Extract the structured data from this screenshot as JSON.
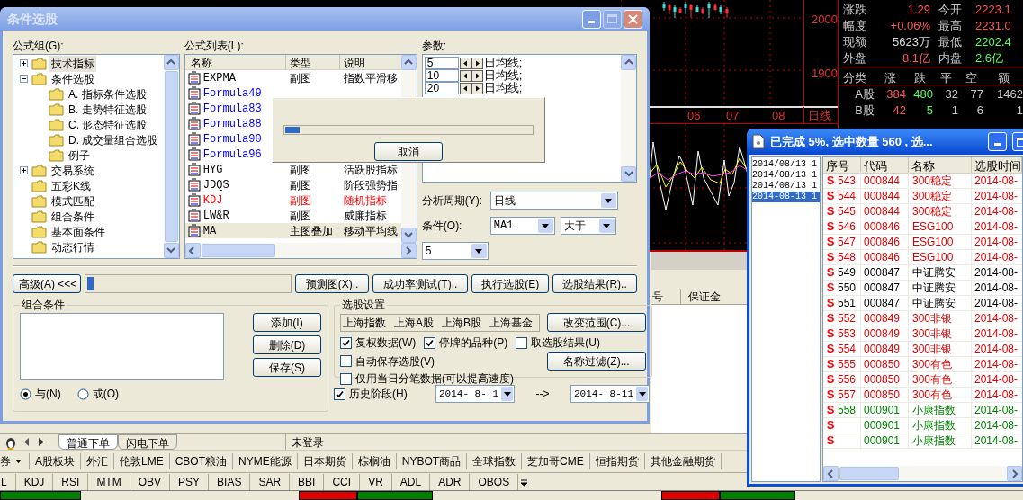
{
  "background": {
    "price_chart": {
      "y_labels": [
        "2000",
        "1900"
      ],
      "x_labels": [
        "06",
        "07",
        "08"
      ],
      "period": "日线"
    },
    "quote": {
      "stats": [
        {
          "label": "涨跌",
          "value": "1.29",
          "color": "#ff5555"
        },
        {
          "label": "今开",
          "value": "2223.1",
          "color": "#ff5555"
        },
        {
          "label": "幅度",
          "value": "+0.06%",
          "color": "#ff5555"
        },
        {
          "label": "最高",
          "value": "2231.0",
          "color": "#ff5555"
        },
        {
          "label": "现额",
          "value": "5623万",
          "color": "#d8d8d8"
        },
        {
          "label": "最低",
          "value": "2202.4",
          "color": "#55ff55"
        },
        {
          "label": "外盘",
          "value": "8.1亿",
          "color": "#ff5555"
        },
        {
          "label": "内盘",
          "value": "2.6亿",
          "color": "#55ff55"
        }
      ],
      "breadth": {
        "columns": [
          "分类",
          "涨",
          "跌",
          "平",
          "空",
          "额"
        ],
        "rows": [
          {
            "name": "A股",
            "values": [
              "384",
              "480",
              "32",
              "77",
              "1462"
            ]
          },
          {
            "name": "B股",
            "values": [
              "42",
              "5",
              "1",
              "6",
              "1"
            ]
          }
        ]
      }
    },
    "orders_table": {
      "columns": [
        "号",
        "保证金"
      ]
    },
    "order_tabs": [
      {
        "label": "普通下单",
        "selected": true
      },
      {
        "label": "闪电下单",
        "selected": false
      }
    ],
    "login_status": "未登录",
    "market_dropdown": "券",
    "market_menu": [
      "A股板块",
      "外汇",
      "伦敦LME",
      "CBOT粮油",
      "NYME能源",
      "日本期货",
      "棕榈油",
      "NYBOT商品",
      "全球指数",
      "芝加哥CME",
      "恒指期货",
      "其他金融期货"
    ],
    "indicators": [
      "L",
      "KDJ",
      "RSI",
      "MTM",
      "OBV",
      "PSY",
      "BIAS",
      "SAR",
      "BBI",
      "CCI",
      "VR",
      "ADL",
      "ADR",
      "OBOS"
    ]
  },
  "dialog": {
    "title": "条件选股",
    "formula_group": {
      "label": "公式组(G):",
      "tree": [
        {
          "label": "技术指标",
          "expanded": false,
          "selected": true
        },
        {
          "label": "条件选股",
          "expanded": true,
          "selected": false,
          "children": [
            {
              "label": "A. 指标条件选股",
              "selected": false
            },
            {
              "label": "B. 走势特征选股",
              "selected": false
            },
            {
              "label": "C. 形态特征选股",
              "selected": false
            },
            {
              "label": "D. 成交量组合选股",
              "selected": false
            },
            {
              "label": "例子",
              "selected": false
            }
          ]
        },
        {
          "label": "交易系统",
          "expanded": false,
          "selected": false
        },
        {
          "label": "五彩K线",
          "selected": false
        },
        {
          "label": "模式匹配",
          "selected": false
        },
        {
          "label": "组合条件",
          "selected": false
        },
        {
          "label": "基本面条件",
          "selected": false
        },
        {
          "label": "动态行情",
          "selected": false
        }
      ]
    },
    "formula_list": {
      "label": "公式列表(L):",
      "columns": [
        "名称",
        "类型",
        "说明"
      ],
      "rows": [
        {
          "name": "EXPMA",
          "type": "副图",
          "desc": "指数平滑移",
          "color": "#000000",
          "selected": false
        },
        {
          "name": "Formula49",
          "color": "#0000ff",
          "selected": false
        },
        {
          "name": "Formula83",
          "color": "#0000ff",
          "selected": false
        },
        {
          "name": "Formula88",
          "color": "#0000ff",
          "selected": false
        },
        {
          "name": "Formula90",
          "color": "#0000ff",
          "selected": false
        },
        {
          "name": "Formula96",
          "color": "#0000ff",
          "selected": false
        },
        {
          "name": "HYG",
          "type": "副图",
          "desc": "活跃股指标",
          "color": "#000000",
          "selected": false
        },
        {
          "name": "JDQS",
          "type": "副图",
          "desc": "阶段强势指",
          "color": "#000000",
          "selected": false
        },
        {
          "name": "KDJ",
          "type": "副图",
          "desc": "随机指标",
          "color": "#ff0000",
          "selected": false
        },
        {
          "name": "LW&R",
          "type": "副图",
          "desc": "威廉指标",
          "color": "#000000",
          "selected": false
        },
        {
          "name": "MA",
          "type": "主图叠加",
          "desc": "移动平均线",
          "color": "#000000",
          "selected": true
        }
      ]
    },
    "params": {
      "label": "参数:",
      "rows": [
        {
          "value": "5",
          "unit": "日均线;"
        },
        {
          "value": "10",
          "unit": "日均线;"
        },
        {
          "value": "20",
          "unit": "日均线;"
        }
      ]
    },
    "analysis_period": {
      "label": "分析周期(Y):",
      "value": "日线"
    },
    "condition": {
      "label": "条件(O):",
      "line": "MA1",
      "operator": "大于",
      "value": "5"
    },
    "advanced_button": "高级(A) <<<",
    "progress": {
      "level": 0.03
    },
    "actions": [
      "预测图(X)..",
      "成功率测试(T)..",
      "执行选股(E)",
      "选股结果(R).."
    ],
    "combo": {
      "title": "组合条件",
      "buttons": [
        "添加(I)",
        "删除(D)",
        "保存(S)"
      ],
      "logic": [
        {
          "label": "与(N)",
          "selected": true
        },
        {
          "label": "或(O)",
          "selected": false
        }
      ]
    },
    "settings": {
      "title": "选股设置",
      "markets": [
        "上海指数",
        "上海A股",
        "上海B股",
        "上海基金"
      ],
      "range_button": "改变范围(C)...",
      "filter_button": "名称过滤(Z)...",
      "options": [
        {
          "label": "复权数据(W)",
          "checked": true
        },
        {
          "label": "停牌的品种(P)",
          "checked": true
        },
        {
          "label": "取选股结果(U)",
          "checked": false
        },
        {
          "label": "自动保存选股(V)",
          "checked": false
        },
        {
          "label": "仅用当日分笔数据(可以提高速度)",
          "checked": false
        }
      ]
    },
    "history": {
      "label": "历史阶段(H)",
      "checked": true,
      "from": "2014- 8- 1",
      "arrow": "-->",
      "to": "2014- 8-11"
    },
    "progress_popup": {
      "level": 0.06,
      "cancel": "取消"
    }
  },
  "result_window": {
    "title": "已完成 5%, 选中数量 560 , 选...",
    "history": [
      {
        "text": "2014/08/13 1",
        "selected": false
      },
      {
        "text": "2014/08/13 1",
        "selected": false
      },
      {
        "text": "2014/08/13 1",
        "selected": false
      },
      {
        "text": "2014-08-13 1",
        "selected": true
      }
    ],
    "columns": [
      "序号",
      "代码",
      "名称",
      "选股时间"
    ],
    "rows": [
      {
        "mark": "S",
        "no": "543",
        "code": "000844",
        "name": "300稳定",
        "time": "2014-08-",
        "color": "#e00000"
      },
      {
        "mark": "S",
        "no": "544",
        "code": "000844",
        "name": "300稳定",
        "time": "2014-08-",
        "color": "#e00000"
      },
      {
        "mark": "S",
        "no": "545",
        "code": "000844",
        "name": "300稳定",
        "time": "2014-08-",
        "color": "#e00000"
      },
      {
        "mark": "S",
        "no": "546",
        "code": "000846",
        "name": "ESG100",
        "time": "2014-08-",
        "color": "#e00000"
      },
      {
        "mark": "S",
        "no": "547",
        "code": "000846",
        "name": "ESG100",
        "time": "2014-08-",
        "color": "#e00000"
      },
      {
        "mark": "S",
        "no": "548",
        "code": "000846",
        "name": "ESG100",
        "time": "2014-08-",
        "color": "#e00000"
      },
      {
        "mark": "S",
        "no": "549",
        "code": "000847",
        "name": "中证腾安",
        "time": "2014-08-",
        "color": "#000000"
      },
      {
        "mark": "S",
        "no": "550",
        "code": "000847",
        "name": "中证腾安",
        "time": "2014-08-",
        "color": "#000000"
      },
      {
        "mark": "S",
        "no": "551",
        "code": "000847",
        "name": "中证腾安",
        "time": "2014-08-",
        "color": "#000000"
      },
      {
        "mark": "S",
        "no": "552",
        "code": "000849",
        "name": "300非银",
        "time": "2014-08-",
        "color": "#e00000"
      },
      {
        "mark": "S",
        "no": "553",
        "code": "000849",
        "name": "300非银",
        "time": "2014-08-",
        "color": "#e00000"
      },
      {
        "mark": "S",
        "no": "554",
        "code": "000849",
        "name": "300非银",
        "time": "2014-08-",
        "color": "#e00000"
      },
      {
        "mark": "S",
        "no": "555",
        "code": "000850",
        "name": "300有色",
        "time": "2014-08-",
        "color": "#e00000"
      },
      {
        "mark": "S",
        "no": "556",
        "code": "000850",
        "name": "300有色",
        "time": "2014-08-",
        "color": "#e00000"
      },
      {
        "mark": "S",
        "no": "557",
        "code": "000850",
        "name": "300有色",
        "time": "2014-08-",
        "color": "#e00000"
      },
      {
        "mark": "S",
        "no": "558",
        "code": "000901",
        "name": "小康指数",
        "time": "2014-08-",
        "color": "#008000"
      },
      {
        "mark": "S",
        "code": "000901",
        "name": "小康指数",
        "time": "2014-08-",
        "color": "#008000"
      },
      {
        "mark": "S",
        "code": "000901",
        "name": "小康指数",
        "time": "2014-08-",
        "color": "#008000"
      }
    ]
  }
}
